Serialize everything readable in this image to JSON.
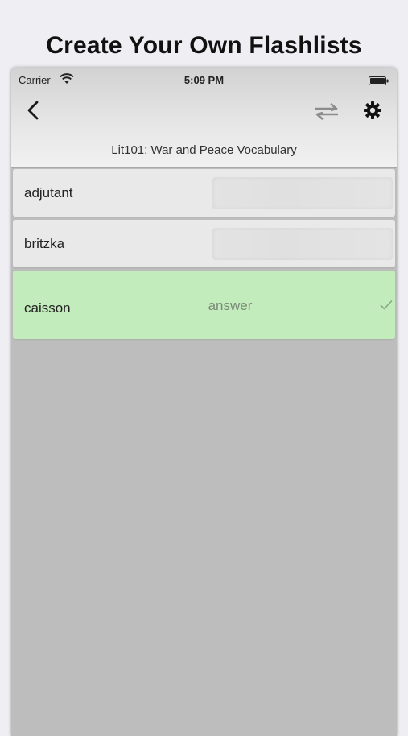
{
  "headline": "Create Your Own Flashlists",
  "status_bar": {
    "carrier": "Carrier",
    "time": "5:09 PM",
    "icons": [
      "wifi-icon",
      "battery-icon"
    ]
  },
  "nav": {
    "back_icon": "chevron-left-icon",
    "swap_icon": "swap-arrows-icon",
    "settings_icon": "gear-icon",
    "list_title": "Lit101: War and Peace Vocabulary"
  },
  "cards": [
    {
      "term": "adjutant"
    },
    {
      "term": "britzka"
    }
  ],
  "active_card": {
    "term": "caisson",
    "answer_placeholder": "answer",
    "check_icon": "checkmark-icon"
  },
  "colors": {
    "active_card_bg": "#c3ecbc",
    "card_bg": "#e9e9e9",
    "list_bg": "#bdbdbd",
    "page_bg": "#eeeef3"
  }
}
